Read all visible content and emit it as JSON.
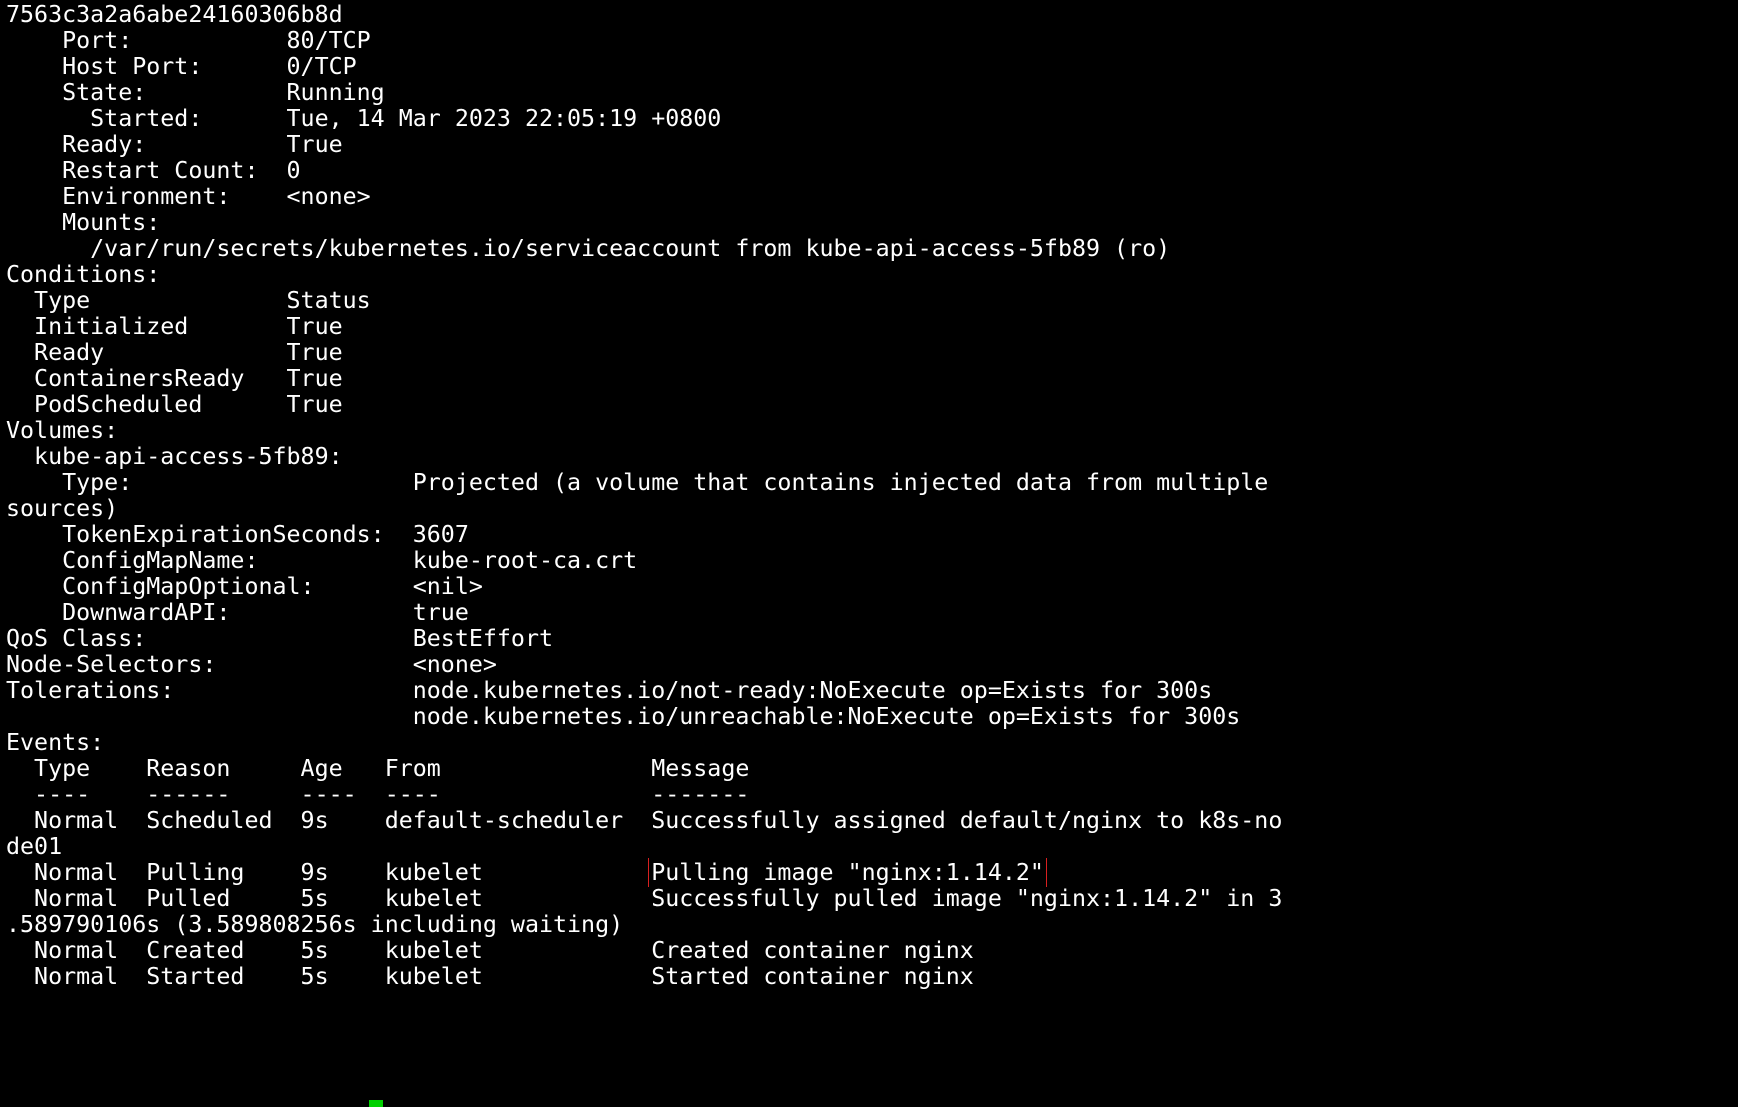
{
  "terminal": {
    "lines": [
      "7563c3a2a6abe24160306b8d",
      "    Port:           80/TCP",
      "    Host Port:      0/TCP",
      "    State:          Running",
      "      Started:      Tue, 14 Mar 2023 22:05:19 +0800",
      "    Ready:          True",
      "    Restart Count:  0",
      "    Environment:    <none>",
      "    Mounts:",
      "      /var/run/secrets/kubernetes.io/serviceaccount from kube-api-access-5fb89 (ro)",
      "Conditions:",
      "  Type              Status",
      "  Initialized       True",
      "  Ready             True",
      "  ContainersReady   True",
      "  PodScheduled      True",
      "Volumes:",
      "  kube-api-access-5fb89:",
      "    Type:                    Projected (a volume that contains injected data from multiple",
      "sources)",
      "    TokenExpirationSeconds:  3607",
      "    ConfigMapName:           kube-root-ca.crt",
      "    ConfigMapOptional:       <nil>",
      "    DownwardAPI:             true",
      "QoS Class:                   BestEffort",
      "Node-Selectors:              <none>",
      "Tolerations:                 node.kubernetes.io/not-ready:NoExecute op=Exists for 300s",
      "                             node.kubernetes.io/unreachable:NoExecute op=Exists for 300s",
      "Events:",
      "  Type    Reason     Age   From               Message",
      "  ----    ------     ----  ----               -------",
      "  Normal  Scheduled  9s    default-scheduler  Successfully assigned default/nginx to k8s-no",
      "de01",
      "  Normal  Pulling    9s    kubelet            ",
      "  Normal  Pulled     5s    kubelet            Successfully pulled image \"nginx:1.14.2\" in 3",
      ".589790106s (3.589808256s including waiting)",
      "  Normal  Created    5s    kubelet            Created container nginx",
      "  Normal  Started    5s    kubelet            Started container nginx"
    ],
    "highlight_text": "Pulling image \"nginx:1.14.2\"",
    "highlight_color": "#d82020",
    "cursor_color": "#00d000"
  }
}
